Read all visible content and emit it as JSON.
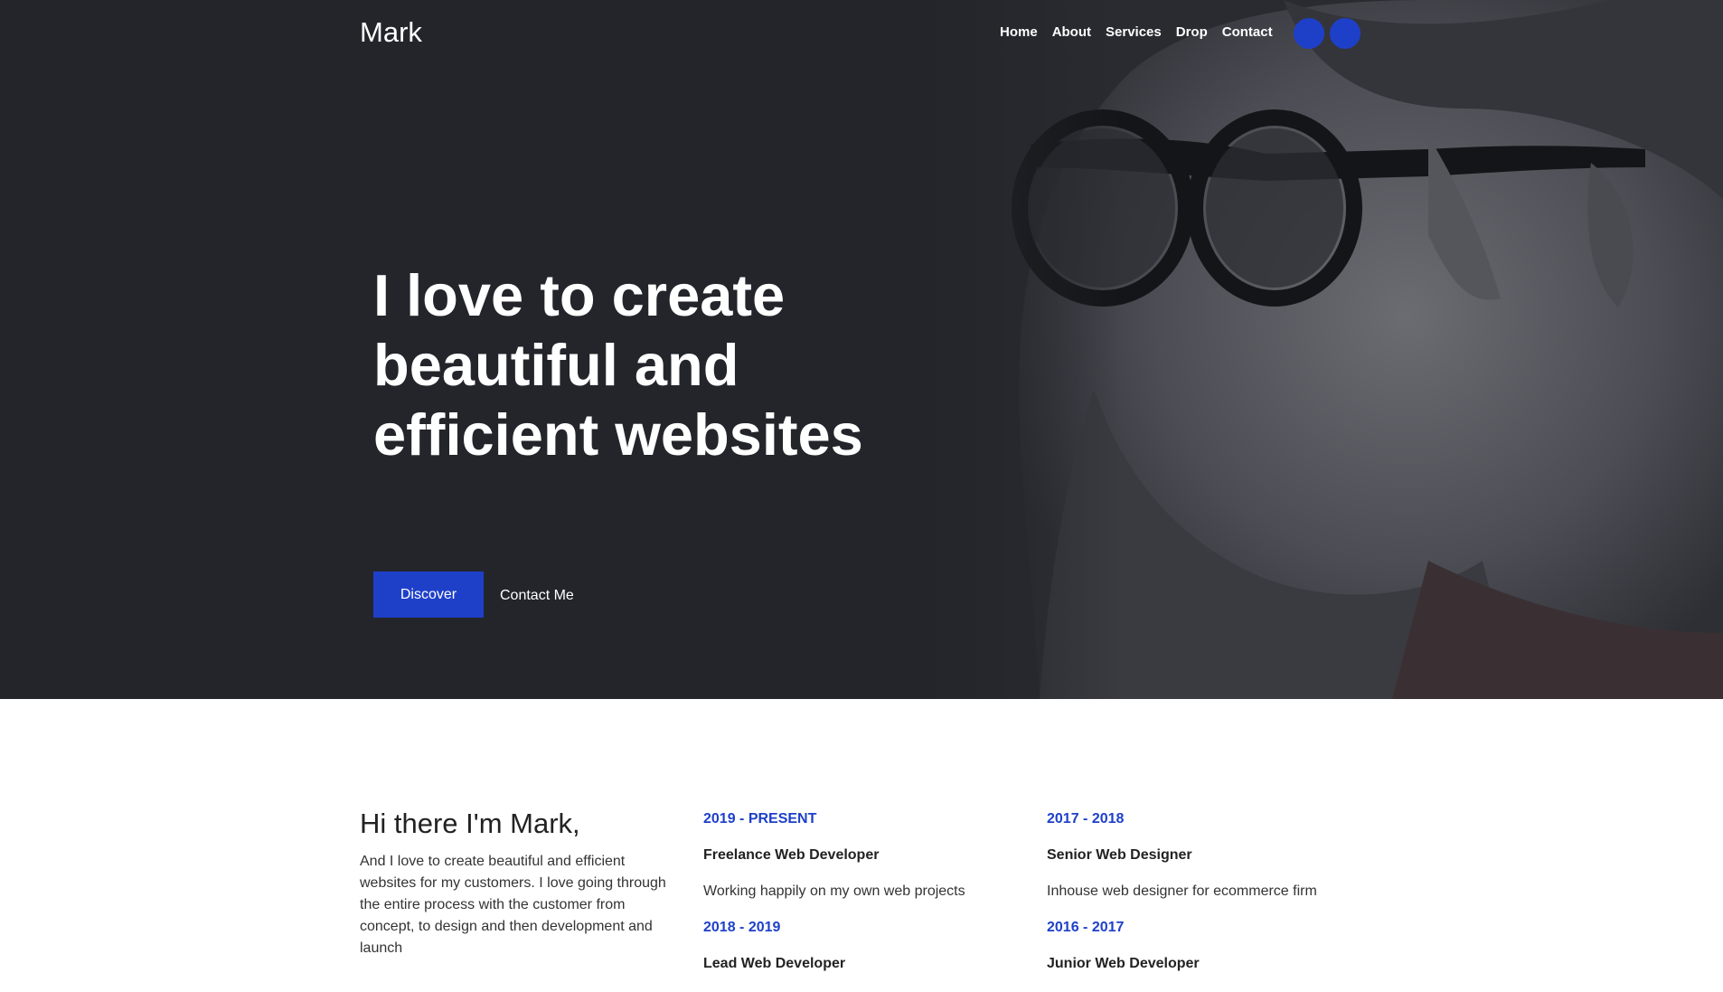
{
  "header": {
    "brand": "Mark",
    "menu": [
      "Home",
      "About",
      "Services",
      "Drop",
      "Contact"
    ],
    "social_icons": [
      "social-icon",
      "social-icon"
    ]
  },
  "hero": {
    "title": "I love to create beautiful and efficient websites",
    "primary_button": "Discover",
    "secondary_button": "Contact Me"
  },
  "about": {
    "title": "Hi there I'm Mark,",
    "text": "And I love to create beautiful and efficient websites for my customers. I love going through the entire process with the customer from concept, to design and then development and launch",
    "columns": [
      [
        {
          "period": "2019 - PRESENT",
          "role": "Freelance Web Developer",
          "desc": "Working happily on my own web projects"
        },
        {
          "period": "2018 - 2019",
          "role": "Lead Web Developer"
        }
      ],
      [
        {
          "period": "2017 - 2018",
          "role": "Senior Web Designer",
          "desc": "Inhouse web designer for ecommerce firm"
        },
        {
          "period": "2016 - 2017",
          "role": "Junior Web Developer"
        }
      ]
    ]
  },
  "colors": {
    "accent": "#1e40c9",
    "hero_bg": "#23252b",
    "text_dark": "#222222"
  }
}
